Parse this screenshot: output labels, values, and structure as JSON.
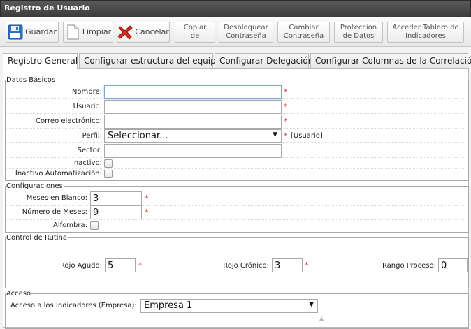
{
  "window": {
    "title": "Registro de Usuario"
  },
  "toolbar": {
    "save": "Guardar",
    "clear": "Limpiar",
    "cancel": "Cancelar",
    "copy_line1": "Copiar",
    "copy_line2": "de",
    "unlock_line1": "Desbloquear",
    "unlock_line2": "Contraseña",
    "change_line1": "Cambiar",
    "change_line2": "Contraseña",
    "protect_line1": "Protección",
    "protect_line2": "de Datos",
    "dash_line1": "Acceder Tablero de",
    "dash_line2": "Indicadores"
  },
  "tabs": [
    {
      "label": "Registro General"
    },
    {
      "label": "Configurar estructura del equipo"
    },
    {
      "label": "Configurar Delegación"
    },
    {
      "label": "Configurar Columnas de la Correlación"
    }
  ],
  "basic": {
    "legend": "Datos Básicos",
    "nombre_label": "Nombre:",
    "nombre_value": "",
    "usuario_label": "Usuario:",
    "usuario_value": "",
    "correo_label": "Correo electrónico:",
    "correo_value": "",
    "perfil_label": "Perfil:",
    "perfil_value": "Seleccionar...",
    "perfil_note": "[Usuario]",
    "sector_label": "Sector:",
    "sector_value": "",
    "inactivo_label": "Inactivo:",
    "inactivo_auto_label": "Inactivo Automatización:"
  },
  "config": {
    "legend": "Configuraciones",
    "meses_blanco_label": "Meses en Blanco:",
    "meses_blanco_value": "3",
    "num_meses_label": "Número de Meses:",
    "num_meses_value": "9",
    "alfombra_label": "Alfombra:"
  },
  "rutina": {
    "legend": "Control de Rutina",
    "rojo_agudo_label": "Rojo Agudo:",
    "rojo_agudo_value": "5",
    "rojo_cronico_label": "Rojo Crónico:",
    "rojo_cronico_value": "3",
    "rango_label": "Rango Proceso:",
    "rango_value": "0"
  },
  "acceso": {
    "legend": "Acceso",
    "indicadores_label": "Acceso a los Indicadores (Empresa):",
    "indicadores_value": "Empresa 1"
  },
  "required_mark": "*",
  "colors": {
    "titlebar": "#444444",
    "required": "#d83232",
    "focus_border": "#7ea6d6"
  }
}
